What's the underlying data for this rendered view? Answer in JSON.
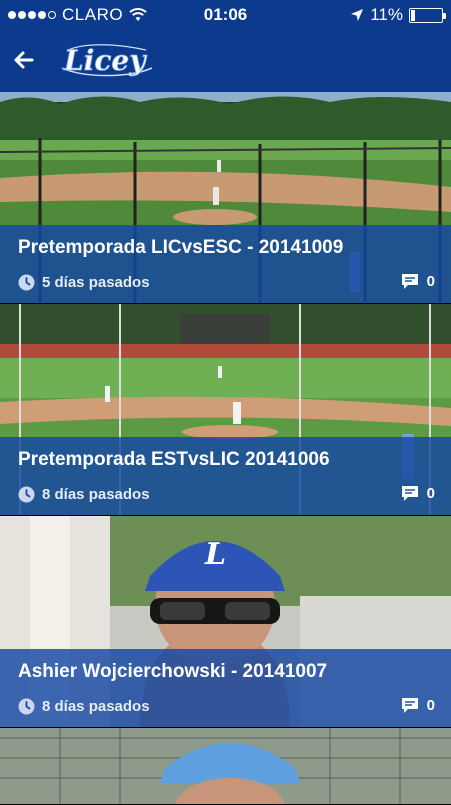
{
  "status_bar": {
    "carrier": "CLARO",
    "signal_bars_filled": 4,
    "signal_bars_total": 5,
    "time": "01:06",
    "battery_percent": "11%",
    "battery_level": 0.11
  },
  "nav": {
    "back_icon": "arrow-left-icon",
    "logo_text": "Licey"
  },
  "videos": [
    {
      "title": "Pretemporada LICvsESC - 20141009",
      "age": "5 días pasados",
      "comments": "0"
    },
    {
      "title": "Pretemporada ESTvsLIC 20141006",
      "age": "8 días pasados",
      "comments": "0"
    },
    {
      "title": "Ashier Wojcierchowski - 20141007",
      "age": "8 días pasados",
      "comments": "0"
    }
  ],
  "colors": {
    "header_blue": "#0c3a8c",
    "overlay_blue": "#1547a4"
  }
}
